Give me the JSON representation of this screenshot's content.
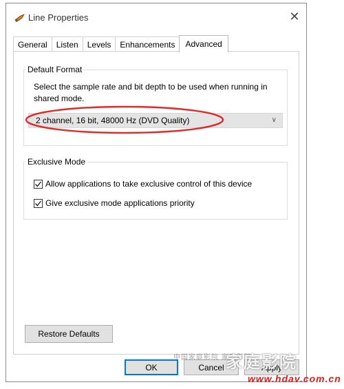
{
  "window": {
    "title": "Line Properties",
    "close_glyph": "✕"
  },
  "tabs": [
    {
      "label": "General",
      "active": false
    },
    {
      "label": "Listen",
      "active": false
    },
    {
      "label": "Levels",
      "active": false
    },
    {
      "label": "Enhancements",
      "active": false
    },
    {
      "label": "Advanced",
      "active": true
    }
  ],
  "default_format": {
    "group_label": "Default Format",
    "description": "Select the sample rate and bit depth to be used when running in shared mode.",
    "selected_format": "2 channel, 16 bit, 48000 Hz (DVD Quality)",
    "highlight_color": "#e02b2b"
  },
  "exclusive_mode": {
    "group_label": "Exclusive Mode",
    "options": [
      {
        "label": "Allow applications to take exclusive control of this device",
        "checked": true
      },
      {
        "label": "Give exclusive mode applications priority",
        "checked": true
      }
    ]
  },
  "buttons": {
    "restore_defaults": "Restore Defaults",
    "ok": "OK",
    "cancel": "Cancel",
    "apply": "Apply"
  },
  "watermark": {
    "small_text": "中国家庭影院 家庭影院",
    "big_text": "家庭影院",
    "url": "www.hdav.com.cn"
  },
  "colors": {
    "accent": "#0078d7",
    "button_bg": "#e1e1e1"
  }
}
